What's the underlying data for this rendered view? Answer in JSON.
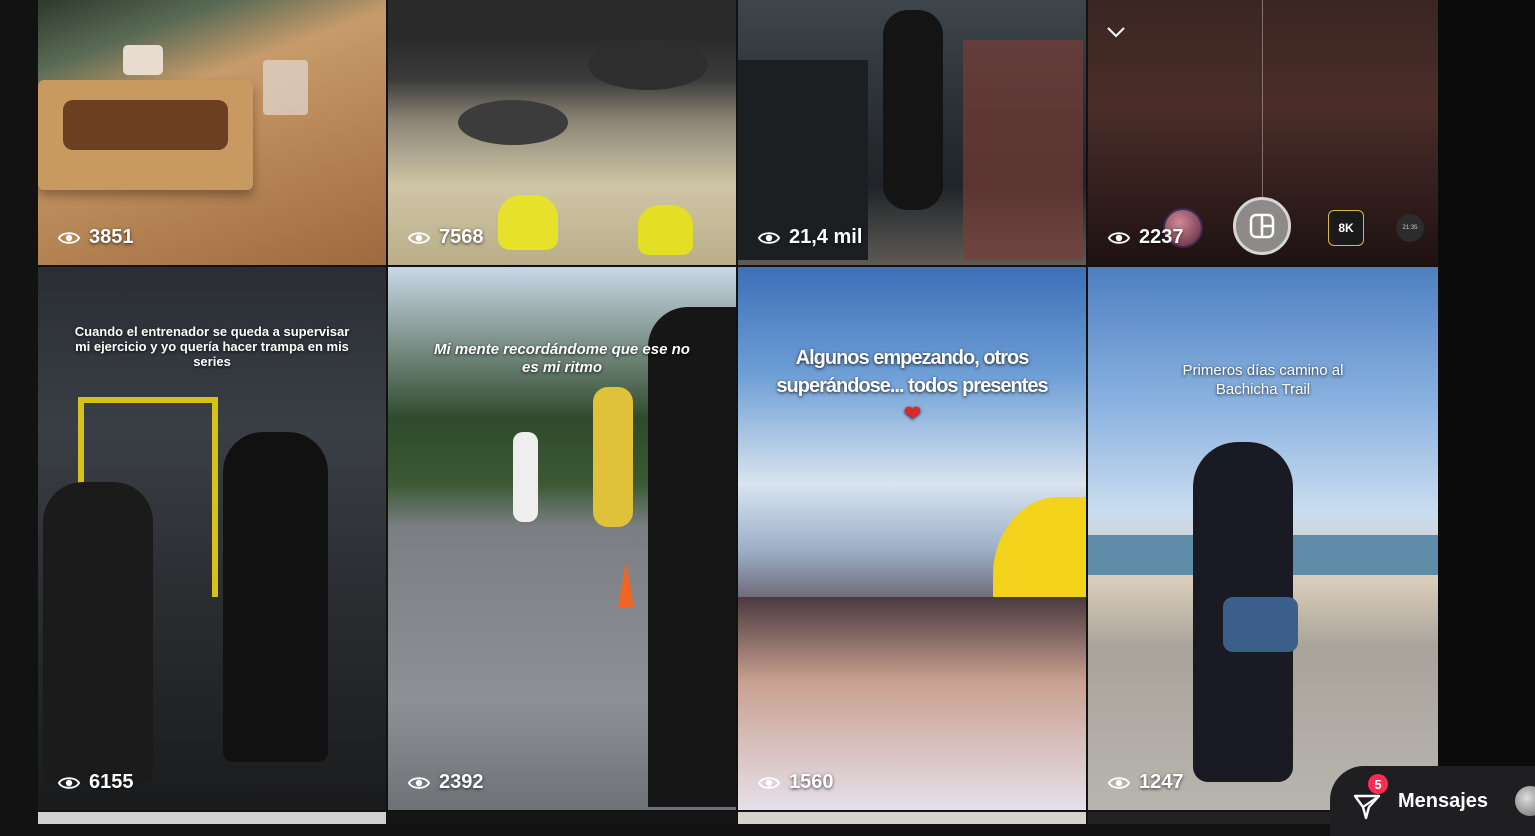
{
  "tiles": [
    {
      "views": "3851"
    },
    {
      "views": "7568"
    },
    {
      "views": "21,4 mil"
    },
    {
      "views": "2237"
    },
    {
      "views": "6155",
      "caption": "Cuando el entrenador se queda a supervisar mi ejercicio y yo quería hacer trampa en mis series"
    },
    {
      "views": "2392",
      "caption": "Mi mente recordándome que ese no es mi ritmo"
    },
    {
      "views": "1560",
      "caption": "Algunos empezando, otros superándose... todos presentes"
    },
    {
      "views": "1247",
      "caption": "Primeros días camino al Bachicha Trail"
    }
  ],
  "camera_overlay": {
    "badge_8k": "8K",
    "time_label": "21:35"
  },
  "messages": {
    "label": "Mensajes",
    "count": "5"
  },
  "colors": {
    "background": "#121212",
    "badge": "#fe2c55",
    "bar": "#1f1f21"
  }
}
